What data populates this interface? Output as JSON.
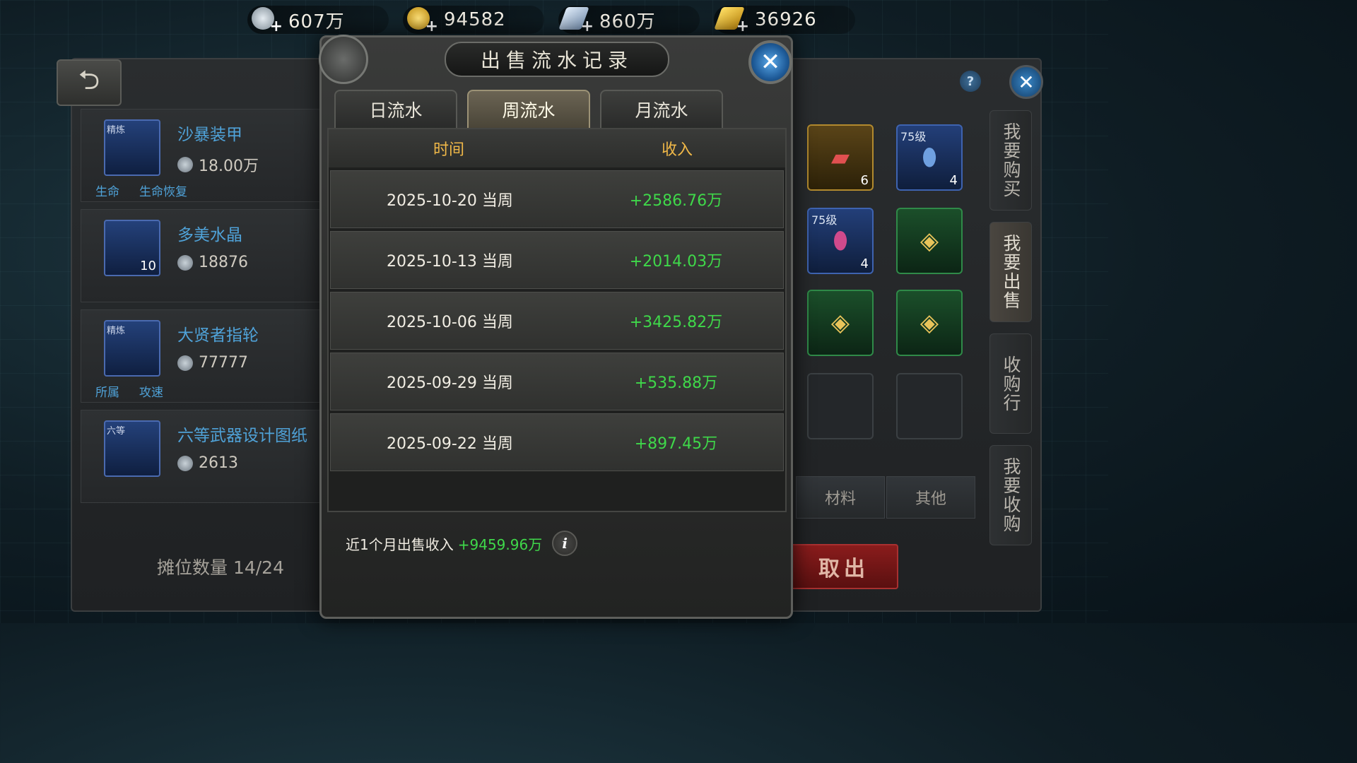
{
  "currencies": [
    {
      "icon": "silver-coin-icon",
      "value": "607万",
      "color": "#b9c4cc"
    },
    {
      "icon": "gold-coin-icon",
      "value": "94582",
      "color": "#e2b32a"
    },
    {
      "icon": "silver-bar-icon",
      "value": "860万",
      "color": "#9fb8d6"
    },
    {
      "icon": "gold-bar-icon",
      "value": "36926",
      "color": "#e8b820"
    }
  ],
  "left_panel": {
    "items": [
      {
        "name": "沙暴装甲",
        "price": "18.00万",
        "tag": "精炼",
        "count": "",
        "attrs": [
          "生命",
          "生命恢复"
        ]
      },
      {
        "name": "多美水晶",
        "price": "18876",
        "tag": "",
        "count": "10",
        "attrs": []
      },
      {
        "name": "大贤者指轮",
        "price": "77777",
        "tag": "精炼",
        "count": "",
        "attrs": [
          "所属",
          "攻速"
        ]
      },
      {
        "name": "六等武器设计图纸",
        "price": "2613",
        "tag": "六等",
        "count": "",
        "attrs": []
      }
    ],
    "slot_count": "摊位数量 14/24"
  },
  "right_panel": {
    "side_tabs": [
      "我要购买",
      "我要出售",
      "收购行",
      "我要收购"
    ],
    "active_side_tab": 1,
    "grid": [
      {
        "style": "gold",
        "level": "",
        "count": "6",
        "glyph": "📕"
      },
      {
        "style": "blue",
        "level": "75级",
        "count": "4",
        "glyph": "🧪"
      },
      {
        "style": "blue",
        "level": "75级",
        "count": "4",
        "glyph": "⚗"
      },
      {
        "style": "green",
        "level": "",
        "count": "",
        "glyph": "⚙"
      },
      {
        "style": "green",
        "level": "",
        "count": "",
        "glyph": "⚙"
      },
      {
        "style": "green",
        "level": "",
        "count": "",
        "glyph": "⚙"
      },
      {
        "style": "empty",
        "level": "",
        "count": "",
        "glyph": ""
      },
      {
        "style": "empty",
        "level": "",
        "count": "",
        "glyph": ""
      }
    ],
    "categories": [
      "材料",
      "其他"
    ],
    "withdraw_label": "取出"
  },
  "modal": {
    "title": "出售流水记录",
    "tabs": [
      "日流水",
      "周流水",
      "月流水"
    ],
    "active_tab": 1,
    "columns": {
      "time": "时间",
      "income": "收入"
    },
    "rows": [
      {
        "time": "2025-10-20 当周",
        "income": "+2586.76万"
      },
      {
        "time": "2025-10-13 当周",
        "income": "+2014.03万"
      },
      {
        "time": "2025-10-06 当周",
        "income": "+3425.82万"
      },
      {
        "time": "2025-09-29 当周",
        "income": "+535.88万"
      },
      {
        "time": "2025-09-22 当周",
        "income": "+897.45万"
      }
    ],
    "footer_label": "近1个月出售收入",
    "footer_total": "+9459.96万",
    "colors": {
      "income": "#3fd84a",
      "header": "#f0b848"
    }
  }
}
